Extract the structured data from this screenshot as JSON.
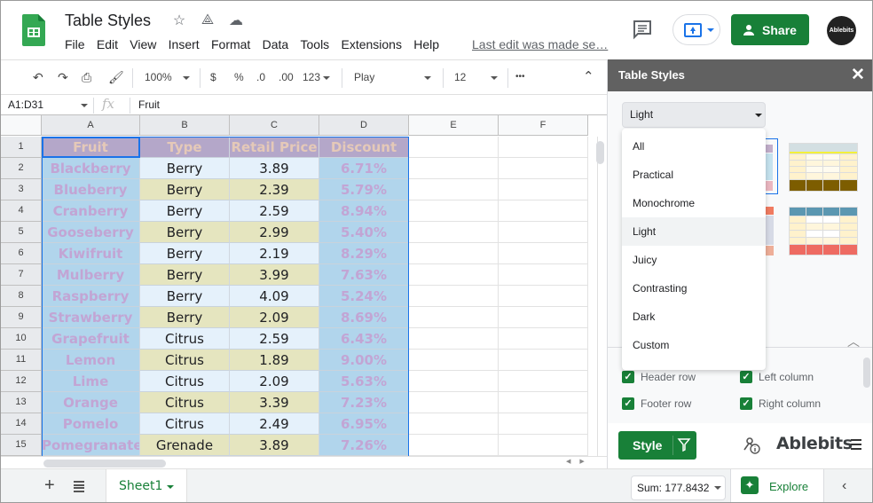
{
  "app": {
    "title": "Table Styles",
    "menu": [
      "File",
      "Edit",
      "View",
      "Insert",
      "Format",
      "Data",
      "Tools",
      "Extensions",
      "Help"
    ],
    "last_edit": "Last edit was made se…",
    "share_label": "Share",
    "avatar_label": "Ablebits"
  },
  "toolbar": {
    "zoom": "100%",
    "currency": "$",
    "percent": "%",
    "dec_decrease": ".0",
    "dec_increase": ".00",
    "format_more": "123",
    "font": "Play",
    "font_size": "12",
    "more": "•••"
  },
  "formula_bar": {
    "name_box": "A1:D31",
    "fx": "fx",
    "value": "Fruit"
  },
  "sheet": {
    "columns": [
      "A",
      "B",
      "C",
      "D",
      "E",
      "F"
    ],
    "rows": [
      [
        "Fruit",
        "Type",
        "Retail Price",
        "Discount"
      ],
      [
        "Blackberry",
        "Berry",
        "3.89",
        "6.71%"
      ],
      [
        "Blueberry",
        "Berry",
        "2.39",
        "5.79%"
      ],
      [
        "Cranberry",
        "Berry",
        "2.59",
        "8.94%"
      ],
      [
        "Gooseberry",
        "Berry",
        "2.99",
        "5.40%"
      ],
      [
        "Kiwifruit",
        "Berry",
        "2.19",
        "8.29%"
      ],
      [
        "Mulberry",
        "Berry",
        "3.99",
        "7.63%"
      ],
      [
        "Raspberry",
        "Berry",
        "4.09",
        "5.24%"
      ],
      [
        "Strawberry",
        "Berry",
        "2.09",
        "8.69%"
      ],
      [
        "Grapefruit",
        "Citrus",
        "2.59",
        "6.43%"
      ],
      [
        "Lemon",
        "Citrus",
        "1.89",
        "9.00%"
      ],
      [
        "Lime",
        "Citrus",
        "2.09",
        "5.63%"
      ],
      [
        "Orange",
        "Citrus",
        "3.39",
        "7.23%"
      ],
      [
        "Pomelo",
        "Citrus",
        "2.49",
        "6.95%"
      ],
      [
        "Pomegranate",
        "Grenade",
        "3.89",
        "7.26%"
      ]
    ]
  },
  "bottom": {
    "sheet_tab": "Sheet1",
    "sum": "Sum: 177.8432",
    "explore": "Explore"
  },
  "panel": {
    "title": "Table Styles",
    "category_selected": "Light",
    "categories": [
      "All",
      "Practical",
      "Monochrome",
      "Light",
      "Juicy",
      "Contrasting",
      "Dark",
      "Custom"
    ],
    "highlighted_category": "Light",
    "options": [
      {
        "label": "Header row",
        "checked": true
      },
      {
        "label": "Left column",
        "checked": true
      },
      {
        "label": "Footer row",
        "checked": true
      },
      {
        "label": "Right column",
        "checked": true
      }
    ],
    "style_button": "Style",
    "brand": "Ablebits"
  },
  "colors": {
    "accent_green": "#188038",
    "selection_blue": "#1a73e8",
    "header_fill": "#b4a7c9",
    "band_fill": "#b1d5ec",
    "odd_fill": "#e5f1fb",
    "even_fill": "#e5e5bf"
  }
}
